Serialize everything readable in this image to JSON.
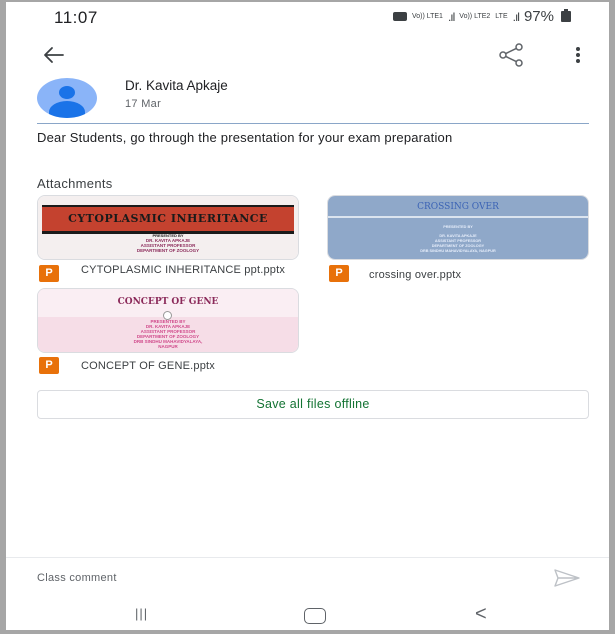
{
  "status_bar": {
    "time": "11:07",
    "net1": "Vo)) LTE1",
    "net2": "Vo)) LTE2",
    "lte": "LTE",
    "battery": "97%"
  },
  "app_bar": {
    "back_icon": "arrow-left-icon",
    "share_icon": "share-icon",
    "more_icon": "more-vert-icon"
  },
  "post": {
    "author": "Dr. Kavita Apkaje",
    "date": "17 Mar",
    "message": "Dear Students, go through the presentation for your exam preparation"
  },
  "attachments": {
    "label": "Attachments",
    "items": [
      {
        "name": "CYTOPLASMIC INHERITANCE ppt.pptx",
        "type_badge": "P",
        "thumb_title": "CYTOPLASMIC INHERITANCE",
        "thumb_presented": "PRESENTED BY",
        "thumb_lines": [
          "DR. KAVITA APKAJE",
          "ASSISTANT PROFESSOR",
          "DEPARTMENT OF ZOOLOGY"
        ]
      },
      {
        "name": "crossing over.pptx",
        "type_badge": "P",
        "thumb_title": "CROSSING OVER",
        "thumb_presented": "PRESENTED BY",
        "thumb_lines": [
          "DR. KAVITA APKAJE",
          "ASSISTANT PROFESSOR",
          "DEPARTMENT OF ZOOLOGY",
          "DRB SINDHU MAHAVIDYALAYA, NAGPUR"
        ]
      },
      {
        "name": "CONCEPT OF GENE.pptx",
        "type_badge": "P",
        "thumb_title": "CONCEPT OF GENE",
        "thumb_presented": "PRESENTED BY",
        "thumb_lines": [
          "DR. KAVITA APKAJE",
          "ASSISTANT PROFESSOR",
          "DEPARTMENT OF ZOOLOGY",
          "DRB SINDHU MAHAVIDYALAYA,",
          "NAGPUR"
        ]
      }
    ]
  },
  "save_button": "Save all files offline",
  "comment": {
    "placeholder": "Class comment",
    "send_icon": "send-icon"
  },
  "nav": {
    "recents": "|||",
    "back": "<"
  },
  "colors": {
    "accent_green": "#137333",
    "ppt_orange": "#e8710a",
    "avatar_blue": "#1a73e8"
  }
}
